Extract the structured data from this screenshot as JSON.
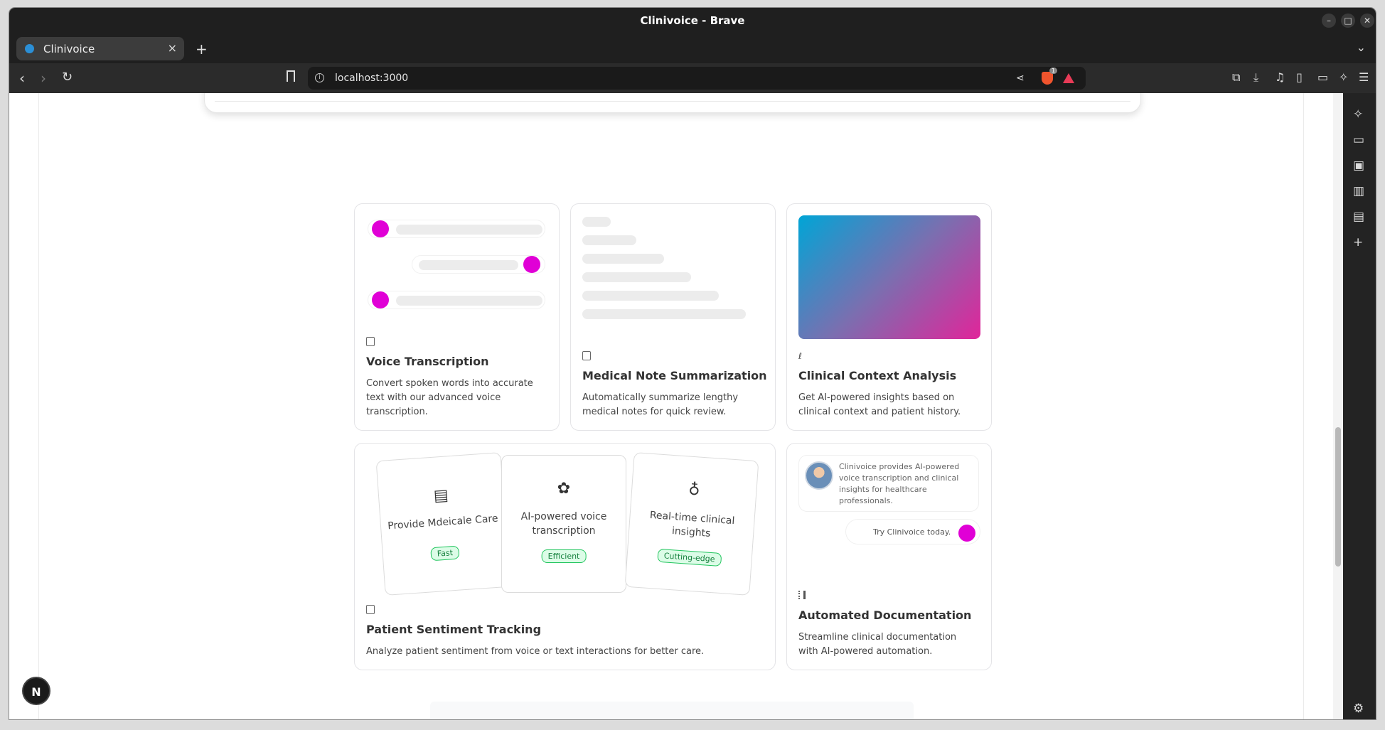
{
  "window": {
    "title": "Clinivoice - Brave"
  },
  "tab": {
    "label": "Clinivoice"
  },
  "address": {
    "url": "localhost:3000"
  },
  "shield_count": "1",
  "features": [
    {
      "title": "Voice Transcription",
      "desc": "Convert spoken words into accurate text with our advanced voice transcription."
    },
    {
      "title": "Medical Note Summarization",
      "desc": "Automatically summarize lengthy medical notes for quick review."
    },
    {
      "title": "Clinical Context Analysis",
      "desc": "Get AI-powered insights based on clinical context and patient history."
    },
    {
      "title": "Patient Sentiment Tracking",
      "desc": "Analyze patient sentiment from voice or text interactions for better care."
    },
    {
      "title": "Automated Documentation",
      "desc": "Streamline clinical documentation with AI-powered automation."
    }
  ],
  "mini_cards": [
    {
      "label": "Provide Mdeicale Care",
      "badge": "Fast",
      "icon": "hospital-icon"
    },
    {
      "label": "AI-powered voice transcription",
      "badge": "Efficient",
      "icon": "brain-icon"
    },
    {
      "label": "Real-time clinical insights",
      "badge": "Cutting-edge",
      "icon": "stethoscope-icon"
    }
  ],
  "chat": {
    "message": "Clinivoice provides AI-powered voice transcription and clinical insights for healthcare professionals.",
    "reply": "Try Clinivoice today."
  },
  "next_badge": "N",
  "colors": {
    "accent_dot": "#e000d6",
    "badge_green": "#22c55e"
  }
}
